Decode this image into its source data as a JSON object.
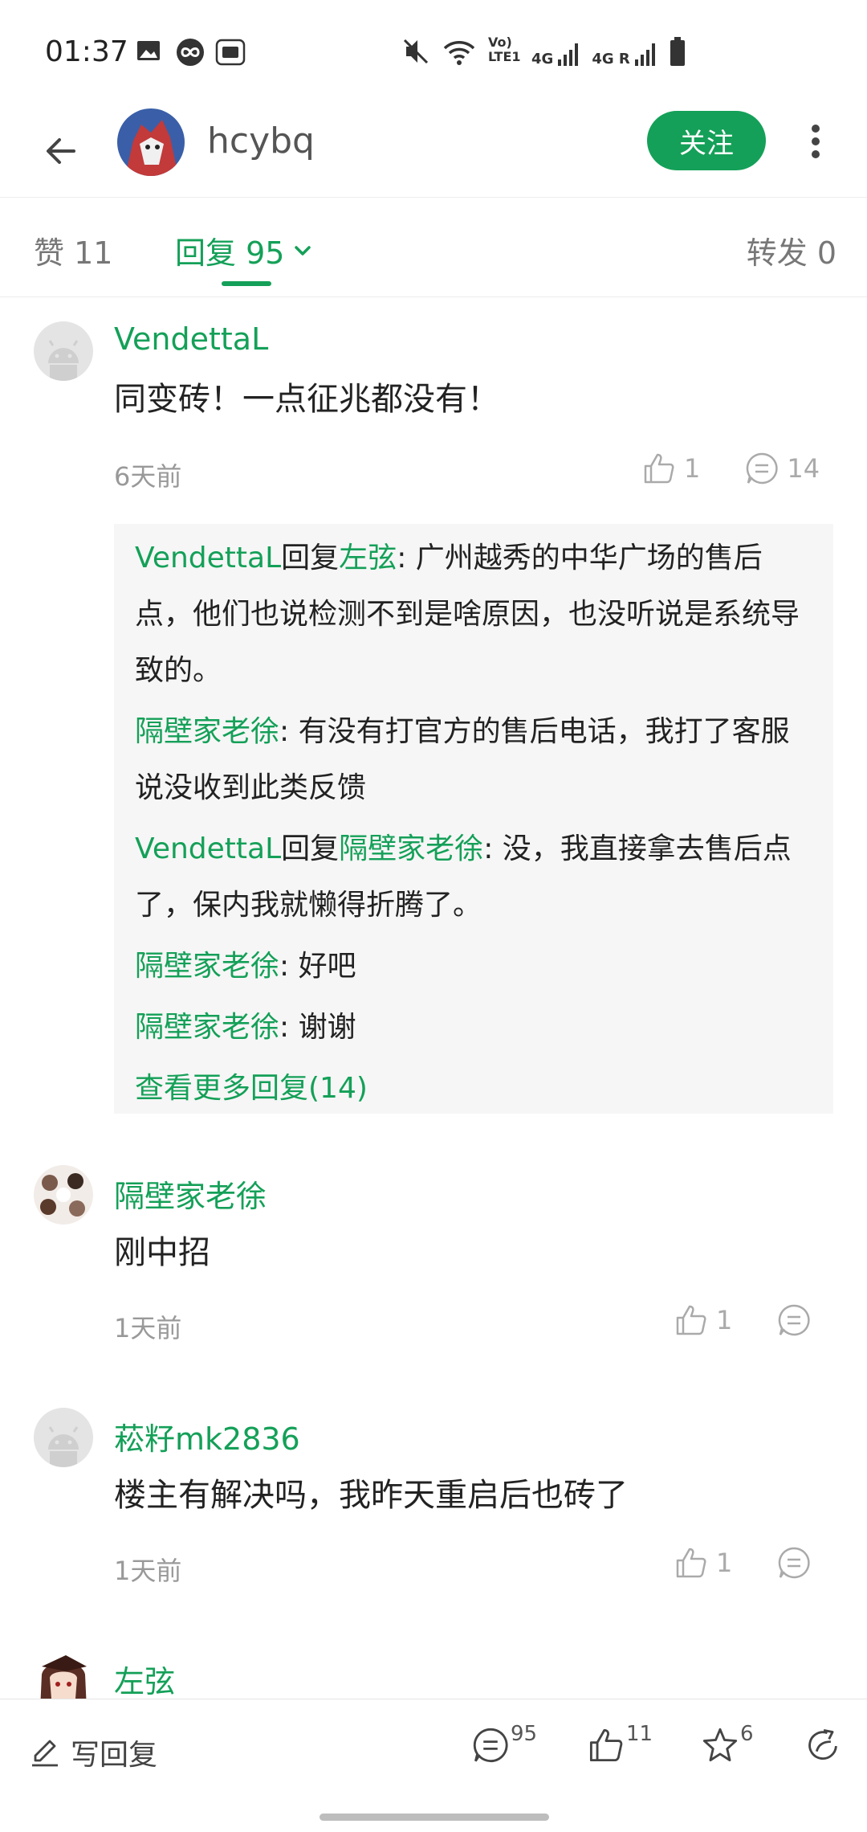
{
  "status_bar": {
    "time": "01:37",
    "left_icons": [
      "image-icon",
      "infinity-icon",
      "folder-icon"
    ],
    "right_icons": [
      "mute-icon",
      "wifi-icon",
      "volte-icon",
      "signal-4g-icon",
      "signal-4g-roaming-icon",
      "battery-icon"
    ],
    "volte_label": "Vo) LTE1",
    "net1": "4G",
    "net2": "4G R"
  },
  "header": {
    "username": "hcybq",
    "follow_label": "关注"
  },
  "tabs": {
    "likes": "赞 11",
    "replies": "回复 95",
    "forwards": "转发 0"
  },
  "comments": [
    {
      "name": "VendettaL",
      "text": "同变砖！一点征兆都没有！",
      "time": "6天前",
      "likes": "1",
      "replies": "14",
      "sub_replies": [
        {
          "from": "VendettaL",
          "verb": "回复",
          "to": "左弦",
          "text": ": 广州越秀的中华广场的售后点，他们也说检测不到是啥原因，也没听说是系统导致的。"
        },
        {
          "from": "隔壁家老徐",
          "verb": "",
          "to": "",
          "text": ": 有没有打官方的售后电话，我打了客服说没收到此类反馈"
        },
        {
          "from": "VendettaL",
          "verb": "回复",
          "to": "隔壁家老徐",
          "text": ": 没，我直接拿去售后点了，保内我就懒得折腾了。"
        },
        {
          "from": "隔壁家老徐",
          "verb": "",
          "to": "",
          "text": ": 好吧"
        },
        {
          "from": "隔壁家老徐",
          "verb": "",
          "to": "",
          "text": ": 谢谢"
        }
      ],
      "more_replies": "查看更多回复(14)"
    },
    {
      "name": "隔壁家老徐",
      "text": "刚中招",
      "time": "1天前",
      "likes": "1",
      "replies": ""
    },
    {
      "name": "菘籽mk2836",
      "text": "楼主有解决吗，我昨天重启后也砖了",
      "time": "1天前",
      "likes": "1",
      "replies": ""
    },
    {
      "name": "左弦"
    }
  ],
  "bottom_bar": {
    "write_reply": "写回复",
    "reply_count": "95",
    "like_count": "11",
    "fav_count": "6"
  },
  "colors": {
    "accent": "#14a058",
    "text": "#222222",
    "muted": "#999999"
  }
}
